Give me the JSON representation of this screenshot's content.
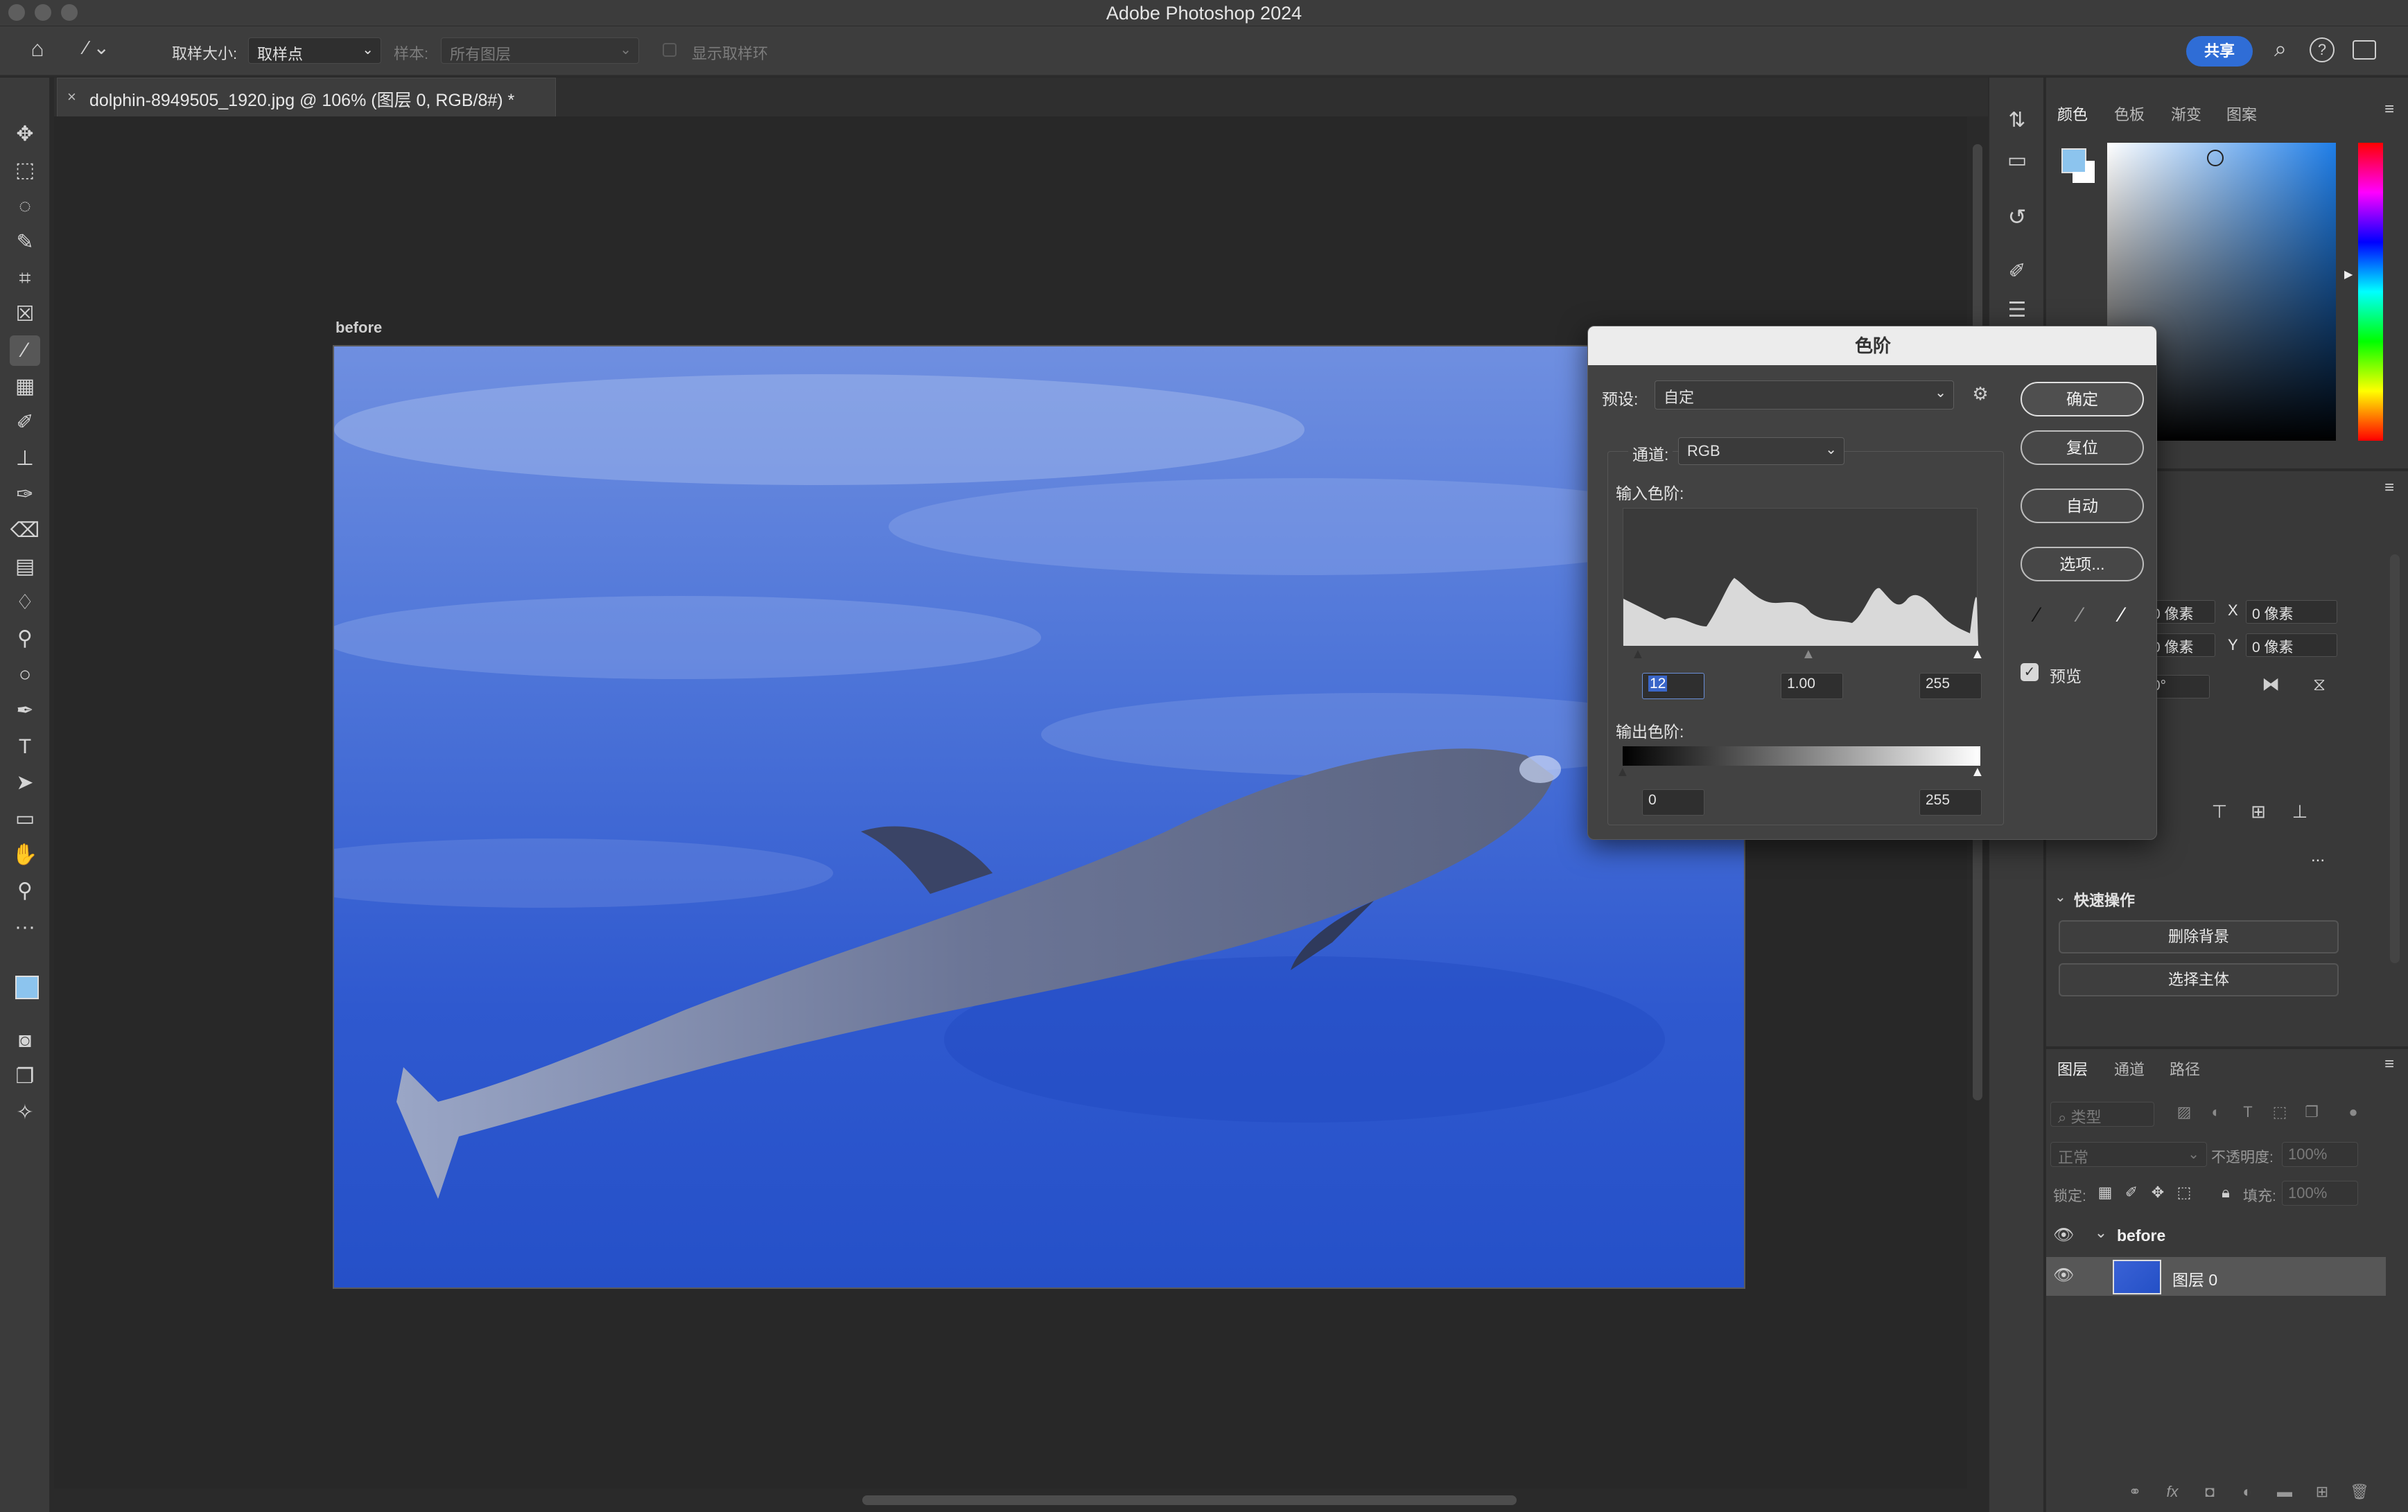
{
  "app": {
    "title": "Adobe Photoshop 2024"
  },
  "options_bar": {
    "sample_size_label": "取样大小:",
    "sample_size_value": "取样点",
    "sample_label": "样本:",
    "sample_value": "所有图层",
    "show_ring_label": "显示取样环",
    "share_label": "共享"
  },
  "document": {
    "tab_title": "dolphin-8949505_1920.jpg @ 106% (图层 0, RGB/8#) *",
    "tab_close": "×",
    "artboard_label": "before"
  },
  "color_panel": {
    "tabs": [
      "颜色",
      "色板",
      "渐变",
      "图案"
    ],
    "foreground_color": "#8cc4ee",
    "background_color": "#ffffff"
  },
  "properties_panel": {
    "w_value": "0 像素",
    "x_label": "X",
    "x_value": "0 像素",
    "h_value": "0 像素",
    "y_label": "Y",
    "y_value": "0 像素",
    "angle_value": "0°",
    "quick_actions_label": "快速操作",
    "remove_bg_label": "删除背景",
    "select_subject_label": "选择主体",
    "more_label": "..."
  },
  "layers_panel": {
    "tabs": [
      "图层",
      "通道",
      "路径"
    ],
    "filter_placeholder": "类型",
    "blend_mode": "正常",
    "opacity_label": "不透明度:",
    "opacity_value": "100%",
    "lock_label": "锁定:",
    "fill_label": "填充:",
    "fill_value": "100%",
    "layers": [
      {
        "name": "before",
        "type": "group",
        "visible": true
      },
      {
        "name": "图层 0",
        "type": "pixel",
        "visible": true,
        "selected": true
      }
    ]
  },
  "levels_dialog": {
    "title": "色阶",
    "preset_label": "预设:",
    "preset_value": "自定",
    "channel_label": "通道:",
    "channel_value": "RGB",
    "input_levels_label": "输入色阶:",
    "input_black": "12",
    "input_gamma": "1.00",
    "input_white": "255",
    "output_levels_label": "输出色阶:",
    "output_black": "0",
    "output_white": "255",
    "ok_label": "确定",
    "reset_label": "复位",
    "auto_label": "自动",
    "options_label": "选项...",
    "preview_label": "预览",
    "preview_checked": true
  }
}
